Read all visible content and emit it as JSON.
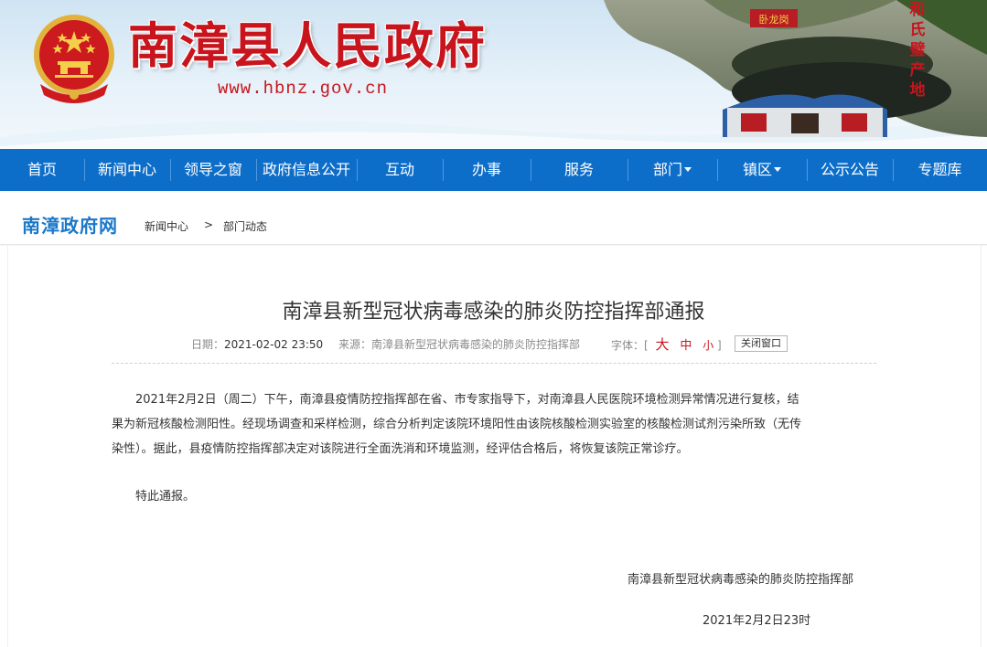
{
  "header": {
    "site_title": "南漳县人民政府",
    "site_url": "www.hbnz.gov.cn",
    "poem": [
      "和",
      "氏",
      "璧",
      "产",
      "地"
    ],
    "temple_sign": "卧龙岗"
  },
  "nav": {
    "items": [
      "首页",
      "新闻中心",
      "领导之窗",
      "政府信息公开",
      "互动",
      "办事",
      "服务",
      "部门",
      "镇区",
      "公示公告",
      "专题库"
    ]
  },
  "breadcrumb": {
    "logo": "南漳政府网",
    "level1": "新闻中心",
    "separator": ">",
    "level2": "部门动态"
  },
  "article": {
    "title": "南漳县新型冠状病毒感染的肺炎防控指挥部通报",
    "date_label": "日期：",
    "date_value": "2021-02-02 23:50",
    "source_label": "来源：",
    "source_value": "南漳县新型冠状病毒感染的肺炎防控指挥部",
    "font_label": "字体：[",
    "font_large": "大",
    "font_medium": "中",
    "font_small": "小",
    "font_close": "]",
    "close_button": "关闭窗口",
    "paragraph1_line1": "2021年2月2日（周二）下午，南漳县疫情防控指挥部在省、市专家指导下，对南漳县人民医院环境检测异常情况进行复核，结",
    "paragraph1_line2": "果为新冠核酸检测阳性。经现场调查和采样检测，综合分析判定该院环境阳性由该院核酸检测实验室的核酸检测试剂污染所致（无传",
    "paragraph1_line3": "染性）。据此，县疫情防控指挥部决定对该院进行全面洗消和环境监测，经评估合格后，将恢复该院正常诊疗。",
    "paragraph2": "特此通报。",
    "signature": "南漳县新型冠状病毒感染的肺炎防控指挥部",
    "sign_date": "2021年2月2日23时"
  },
  "colors": {
    "brand_red": "#c8151d",
    "nav_blue": "#0d6ec9",
    "logo_blue": "#1a77c9"
  }
}
